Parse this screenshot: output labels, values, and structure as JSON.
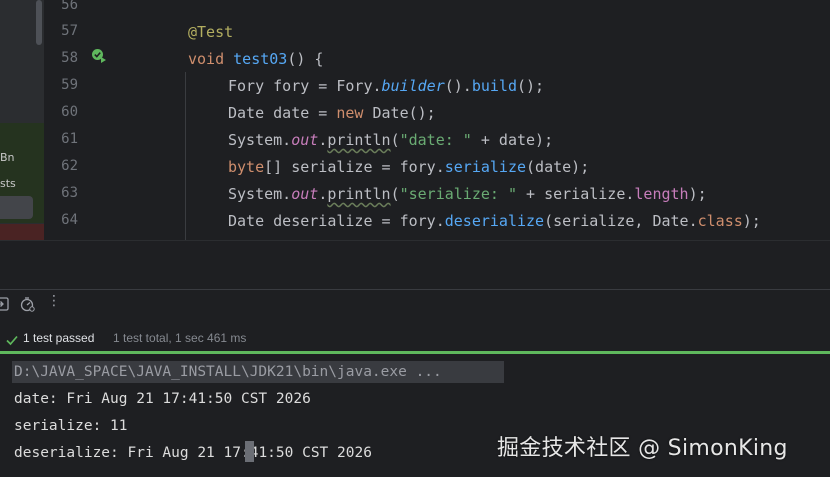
{
  "left_panel": {
    "label_bn": "Bn",
    "label_sts": "sts"
  },
  "editor": {
    "line_numbers": [
      "56",
      "57",
      "58",
      "59",
      "60",
      "61",
      "62",
      "63",
      "64"
    ],
    "lines": {
      "l57": {
        "annotation": "@Test"
      },
      "l58": {
        "kw_void": "void",
        "method": "test03",
        "rest": "() {"
      },
      "l59": {
        "t1": "Fory fory = Fory.",
        "builder": "builder",
        "t2": "().",
        "build": "build",
        "t3": "();"
      },
      "l60": {
        "t1": "Date date = ",
        "kw_new": "new",
        "t2": " Date();"
      },
      "l61": {
        "t1": "System.",
        "out": "out",
        "t2": ".",
        "println": "println",
        "t3": "(",
        "str": "\"date: \"",
        "t4": " + date);"
      },
      "l62": {
        "kw_byte": "byte",
        "t1": "[] serialize = fory.",
        "serialize": "serialize",
        "t2": "(date);"
      },
      "l63": {
        "t1": "System.",
        "out": "out",
        "t2": ".",
        "println": "println",
        "t3": "(",
        "str": "\"serialize: \"",
        "t4": " + serialize.",
        "length": "length",
        "t5": ");"
      },
      "l64": {
        "t1": "Date deserialize = fory.",
        "deserialize": "deserialize",
        "t2": "(serialize, Date.",
        "kw_class": "class",
        "t3": ");"
      }
    }
  },
  "run_toolbar": {
    "more_label": "⋮"
  },
  "status": {
    "passed": "1 test passed",
    "total": "1 test total, 1 sec 461 ms"
  },
  "console": {
    "command": "D:\\JAVA_SPACE\\JAVA_INSTALL\\JDK21\\bin\\java.exe ...",
    "line1": "date: Fri Aug 21 17:41:50 CST 2026",
    "line2": "serialize: 11",
    "line3_a": "deserialize: Fri Aug 21",
    "line3_b": "17:41:50 CST 2026"
  },
  "watermark": "掘金技术社区 @ SimonKing",
  "colors": {
    "background": "#1e1f22",
    "keyword": "#cf8e6d",
    "annotation": "#b3ae60",
    "method": "#56a8f5",
    "string": "#6aab73",
    "field": "#c77dbb",
    "success": "#5fb85d"
  },
  "icons": {
    "run_gutter": "run-test-passed-icon",
    "toolbar_1": "import-icon",
    "toolbar_2": "timer-icon",
    "status": "check-icon"
  }
}
